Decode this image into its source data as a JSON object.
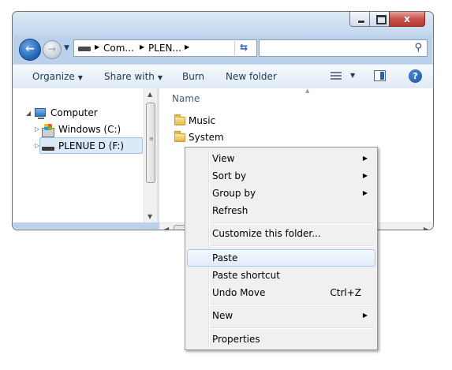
{
  "window": {
    "min_glyph": "",
    "max_glyph": "",
    "close_glyph": "x"
  },
  "address": {
    "crumbs": [
      "Com...",
      "PLEN..."
    ],
    "search_placeholder": ""
  },
  "toolbar": {
    "organize": "Organize",
    "share_with": "Share with",
    "burn": "Burn",
    "new_folder": "New folder",
    "help": "?"
  },
  "nav": {
    "computer": "Computer",
    "windows": "Windows (C:)",
    "plenue": "PLENUE  D  (F:)"
  },
  "content": {
    "column_name": "Name",
    "files": [
      "Music",
      "System"
    ]
  },
  "context_menu": {
    "items": [
      {
        "label": "View",
        "submenu": true
      },
      {
        "label": "Sort by",
        "submenu": true
      },
      {
        "label": "Group by",
        "submenu": true
      },
      {
        "label": "Refresh"
      },
      {
        "label": "Customize this folder..."
      },
      {
        "label": "Paste",
        "highlighted": true
      },
      {
        "label": "Paste shortcut"
      },
      {
        "label": "Undo Move",
        "shortcut": "Ctrl+Z"
      },
      {
        "label": "New",
        "submenu": true
      },
      {
        "label": "Properties"
      }
    ]
  },
  "colors": {
    "frame": "#b9d1ea",
    "highlight": "#dbeaf9",
    "close_button": "#c75050"
  }
}
